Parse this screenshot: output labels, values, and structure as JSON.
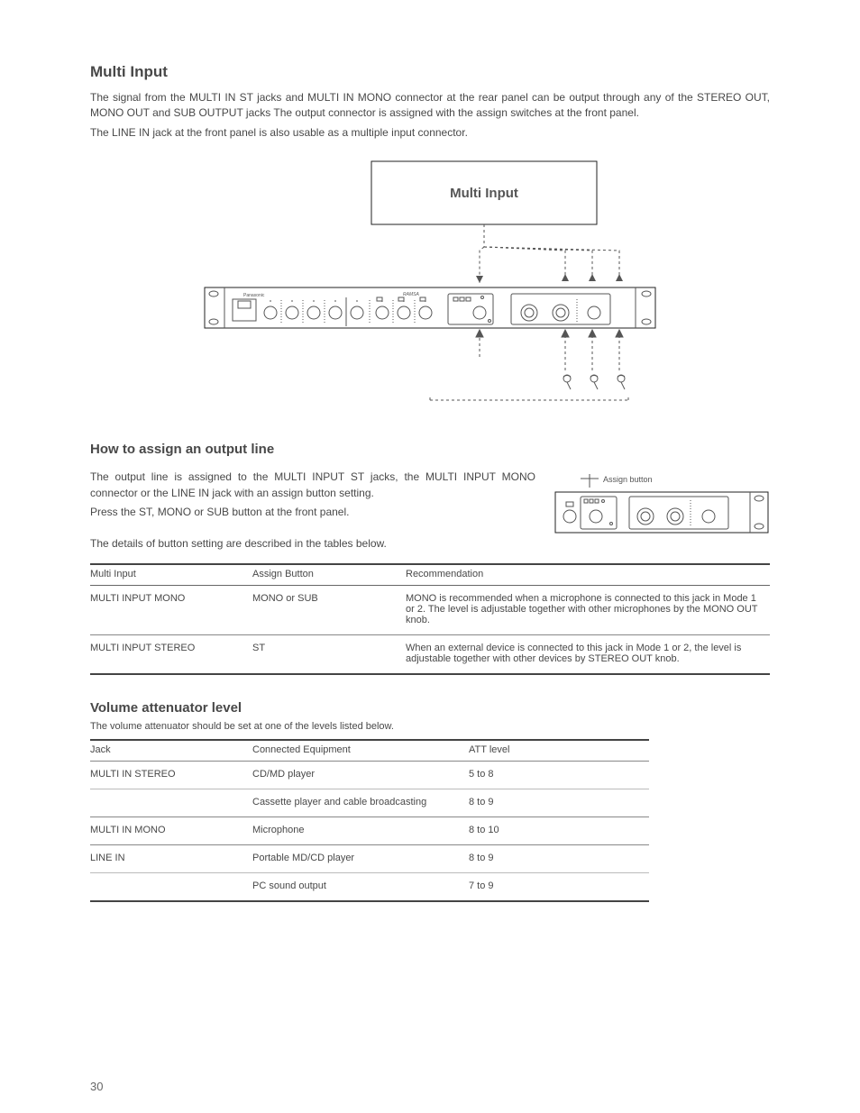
{
  "title": "Multi Input",
  "intro_p1": "The signal from the MULTI IN ST jacks and MULTI IN MONO connector at the rear panel can be output through any of the STEREO OUT, MONO OUT and SUB OUTPUT jacks The output connector is assigned with the assign switches at the front panel.",
  "intro_p2": "The LINE IN jack at the front panel is also usable as a multiple input connector.",
  "figure1": {
    "caption": "Multi Input"
  },
  "figure2_caption": "Assign button",
  "section_assign": "How to assign an output line",
  "assign_p1": "The output line is assigned to the MULTI INPUT ST jacks, the MULTI INPUT MONO connector or the LINE IN jack with an assign button setting.",
  "assign_p2": "Press the ST, MONO or SUB button at the front panel.",
  "assign_p3": "The details of button setting are described in the tables below.",
  "assign_table": {
    "headers": [
      "Multi Input",
      "Assign Button",
      "Recommendation"
    ],
    "rows": [
      {
        "multi_input": "MULTI INPUT MONO",
        "assign_button": "MONO or SUB",
        "recommendation": "MONO is recommended when a microphone is connected to this jack in Mode 1 or 2. The level is adjustable together with other microphones by the MONO OUT knob."
      },
      {
        "multi_input": "MULTI INPUT STEREO",
        "assign_button": "ST",
        "recommendation": "When an external device is connected to this jack in Mode 1 or 2, the level is adjustable together with other devices by STEREO OUT knob.",
        "sep": true
      }
    ]
  },
  "atten_title": "Volume attenuator level",
  "atten_note": "The volume attenuator should be set at one of the levels listed below.",
  "atten_table": {
    "headers": [
      "Jack",
      "Connected Equipment",
      "ATT level"
    ],
    "rows": [
      {
        "jack": "MULTI IN STEREO",
        "equip": "CD/MD player",
        "att": "5 to 8",
        "sep": true
      },
      {
        "jack": "",
        "equip": "Cassette player and cable broadcasting",
        "att": "8 to 9",
        "thin": true
      },
      {
        "jack": "MULTI IN MONO",
        "equip": "Microphone",
        "att": "8 to 10",
        "sep": true
      },
      {
        "jack": "LINE IN",
        "equip": "Portable MD/CD player",
        "att": "8 to 9",
        "sep": true
      },
      {
        "jack": "",
        "equip": "PC sound output",
        "att": "7 to 9",
        "thin": true
      }
    ]
  },
  "page_number": "30"
}
